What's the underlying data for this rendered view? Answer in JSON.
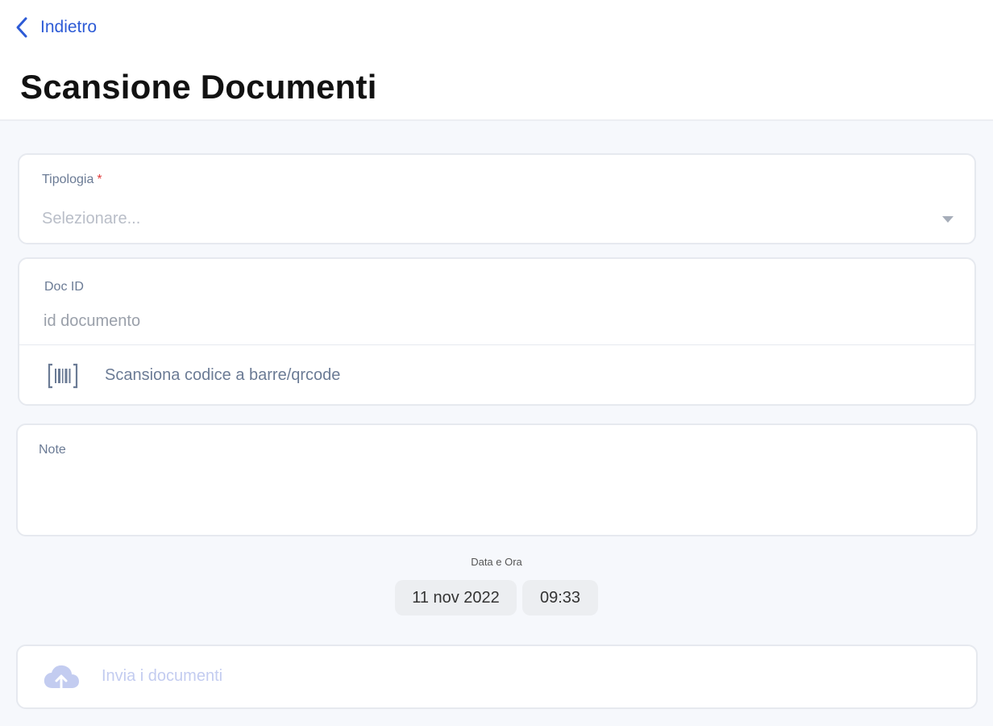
{
  "header": {
    "back_label": "Indietro",
    "title": "Scansione Documenti"
  },
  "tipologia": {
    "label": "Tipologia",
    "required_mark": "*",
    "value": "Selezionare..."
  },
  "doc_id": {
    "label": "Doc ID",
    "placeholder": "id documento",
    "scan_label": "Scansiona codice a barre/qrcode"
  },
  "note": {
    "label": "Note"
  },
  "datetime": {
    "label": "Data e Ora",
    "date": "11 nov 2022",
    "time": "09:33"
  },
  "upload": {
    "label": "Invia i documenti"
  },
  "colors": {
    "accent": "#2d5bd6",
    "label": "#6b7b95",
    "required": "#e03a3a",
    "disabled": "#c3ccf0",
    "background": "#f6f8fc"
  }
}
